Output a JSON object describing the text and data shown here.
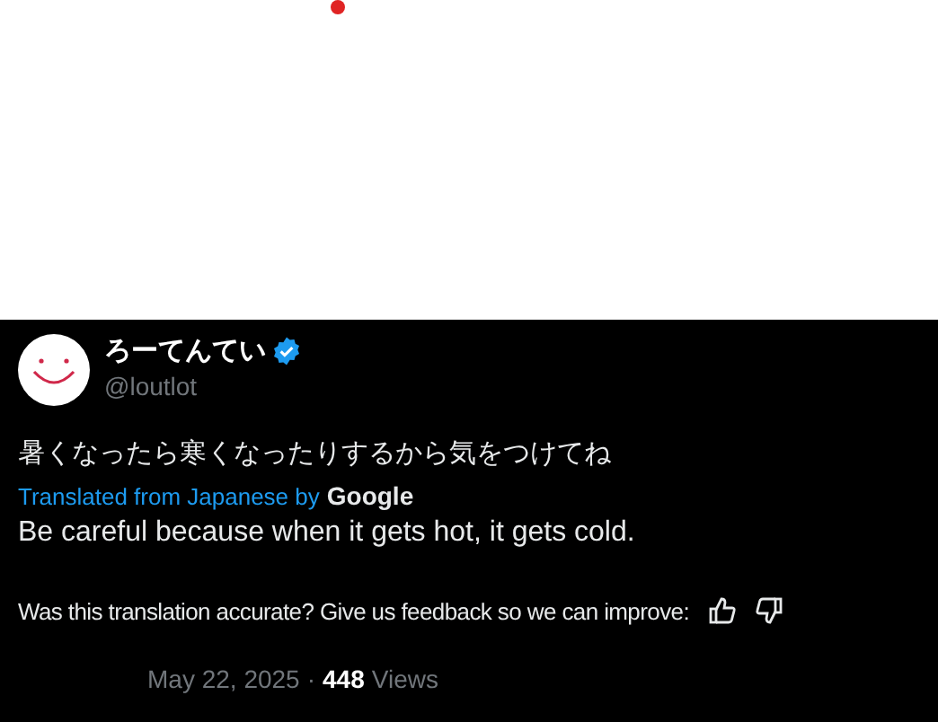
{
  "author": {
    "name": "ろーてんてい",
    "handle": "@loutlot",
    "verified": true
  },
  "text": "暑くなったら寒くなったりするから気をつけてね",
  "translation": {
    "credit": "Translated from Japanese by",
    "provider": "Google",
    "text": "Be careful because when it gets hot, it gets cold."
  },
  "feedback": {
    "prompt": "Was this translation accurate? Give us feedback so we can improve:"
  },
  "meta": {
    "date": "May 22, 2025",
    "separator": "·",
    "views_count": "448",
    "views_label": "Views"
  }
}
